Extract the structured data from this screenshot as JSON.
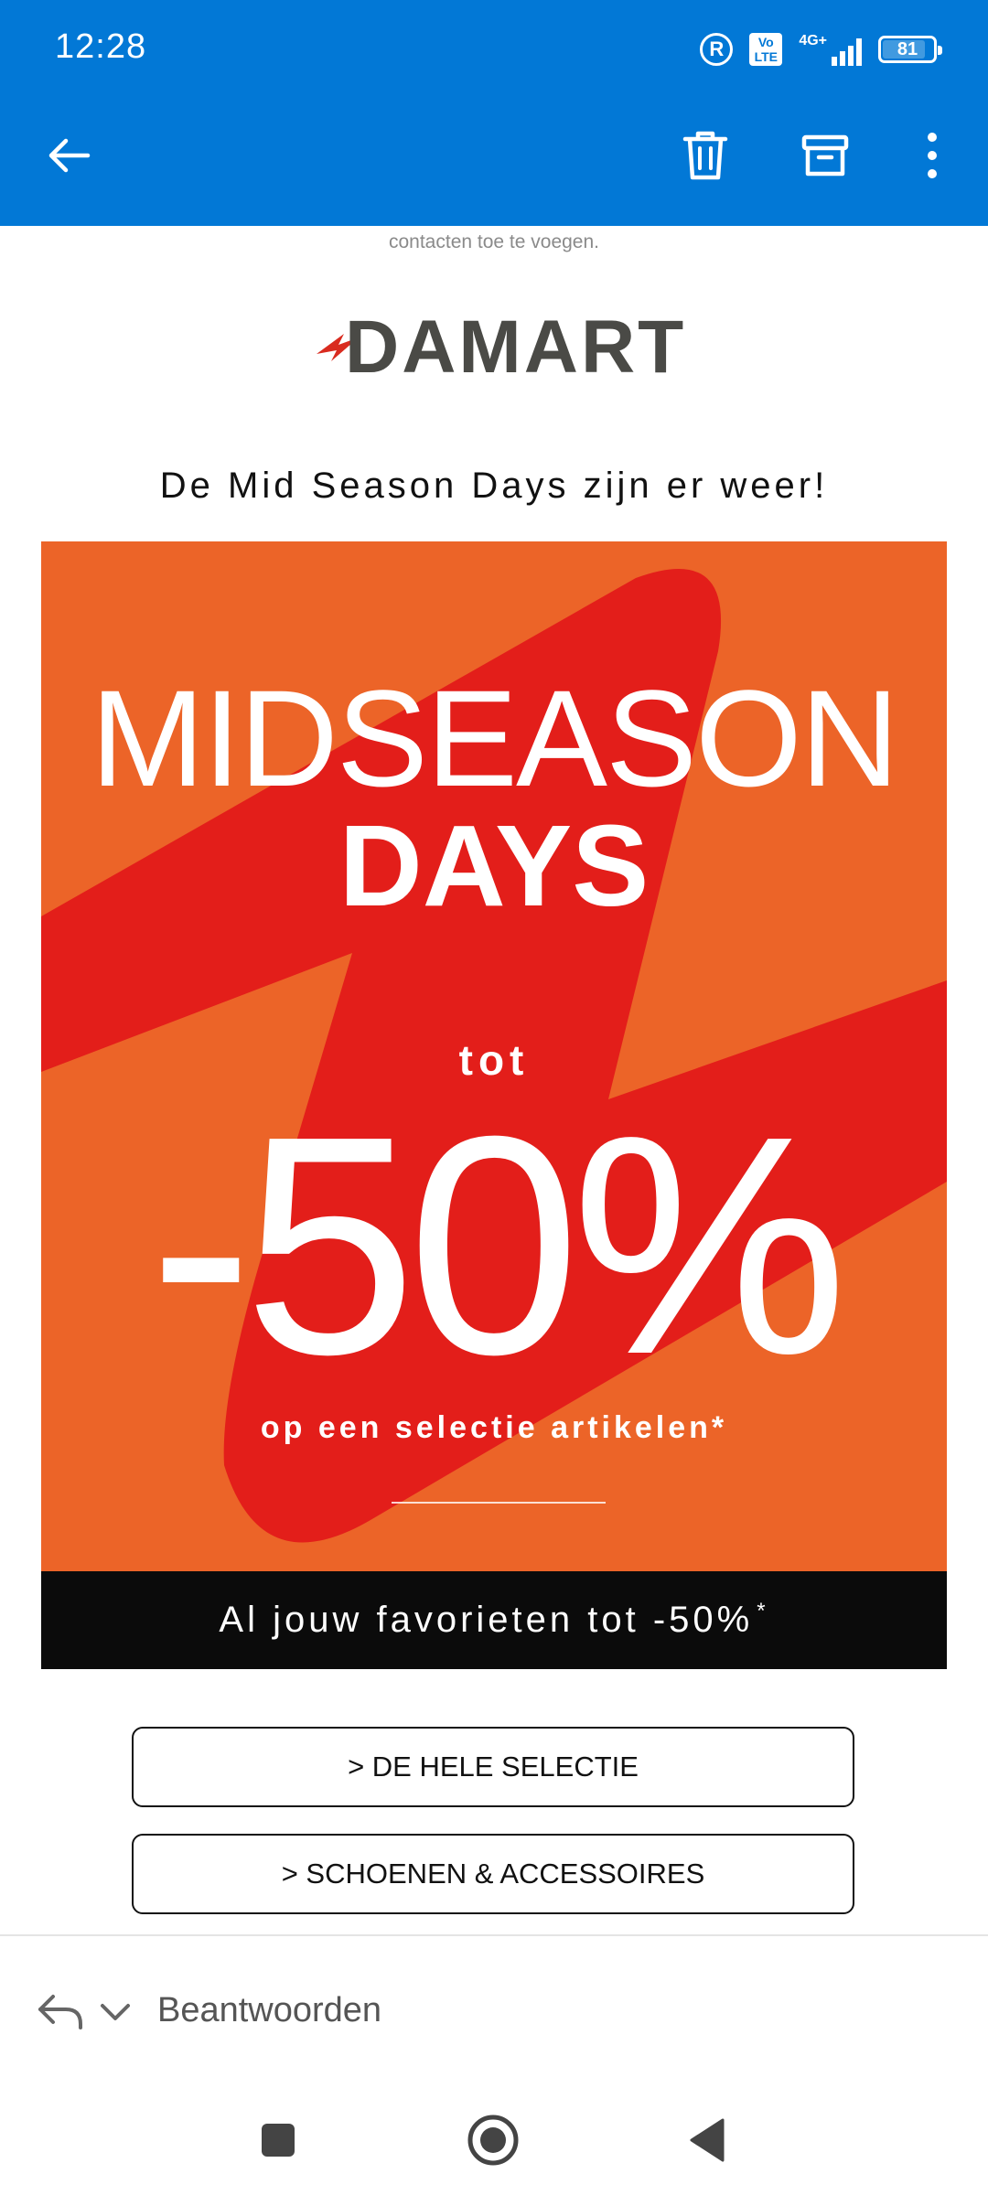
{
  "status_bar": {
    "time": "12:28",
    "reg_icon": "R",
    "volte_label": "Vo LTE",
    "network_label": "4G+",
    "battery_level": "81"
  },
  "toolbar": {
    "back_icon": "arrow-left-icon",
    "delete_icon": "trash-icon",
    "archive_icon": "archive-icon",
    "more_icon": "more-vertical-icon"
  },
  "email": {
    "clipped_text": "contacten toe te voegen.",
    "logo_text": "DAMART",
    "intro_heading": "De Mid Season Days zijn er weer!",
    "banner": {
      "line1": "MIDSEASON",
      "line2": "DAYS",
      "prefix": "tot",
      "discount": "-50%",
      "subtitle": "op een selectie artikelen*"
    },
    "strip_text": "Al jouw favorieten tot -50%",
    "strip_sup": "*",
    "cta_buttons": [
      {
        "label": "> DE HELE SELECTIE"
      },
      {
        "label": "> SCHOENEN & ACCESSOIRES"
      }
    ]
  },
  "reply_bar": {
    "label": "Beantwoorden"
  },
  "colors": {
    "app_bar": "#0278D6",
    "banner_orange": "#EC6428",
    "banner_red": "#E31E1A",
    "strip_black": "#0B0B0B"
  }
}
